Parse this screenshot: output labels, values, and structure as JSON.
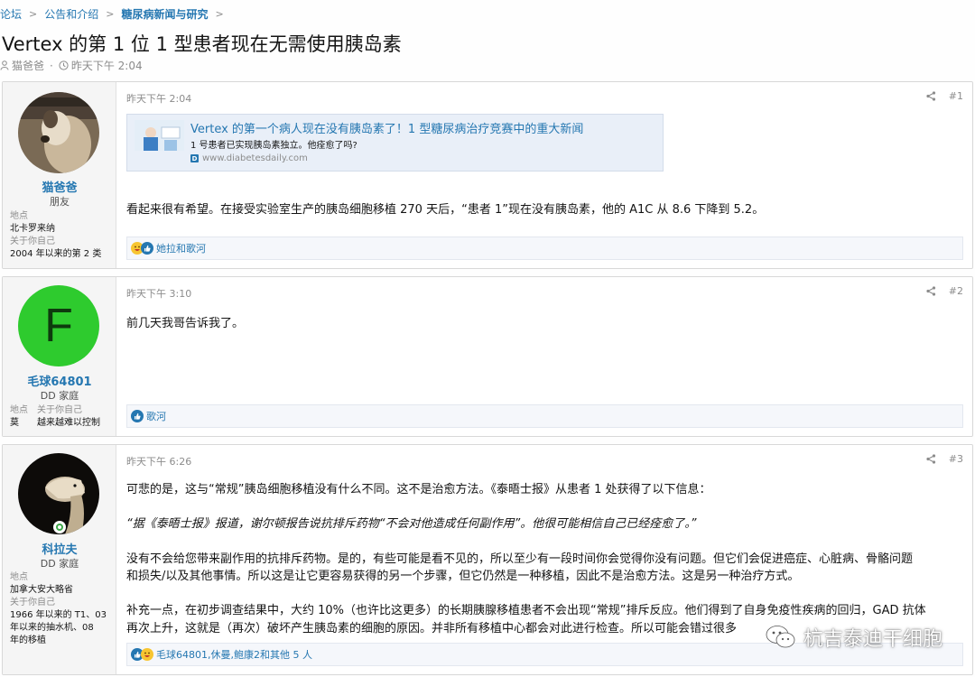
{
  "breadcrumb": {
    "items": [
      "论坛",
      "公告和介绍",
      "糖尿病新闻与研究"
    ]
  },
  "thread": {
    "title": "Vertex 的第 1 位 1 型患者现在无需使用胰岛素",
    "author": "猫爸爸",
    "time": "昨天下午 2:04"
  },
  "posts": [
    {
      "username": "猫爸爸",
      "user_title": "朋友",
      "fields": [
        {
          "label": "地点",
          "value": "北卡罗来纳"
        },
        {
          "label": "关于你自己",
          "value": "2004 年以来的第 2 类"
        }
      ],
      "date": "昨天下午 2:04",
      "number": "#1",
      "link_card": {
        "title": "Vertex 的第一个病人现在没有胰岛素了！1 型糖尿病治疗竞赛中的重大新闻",
        "description": "1 号患者已实现胰岛素独立。他痊愈了吗?",
        "favicon": "D",
        "domain": "www.diabetesdaily.com"
      },
      "body": [
        "看起来很有希望。在接受实验室生产的胰岛细胞移植 270 天后，“患者 1”现在没有胰岛素，他的 A1C 从 8.6 下降到 5.2。"
      ],
      "reactions": "她拉和歌河"
    },
    {
      "username": "毛球64801",
      "user_title": "DD 家庭",
      "avatar_letter": "F",
      "avatar_color": "#2ecb2e",
      "fields": [
        {
          "label": "地点",
          "value": "莫"
        },
        {
          "label": "关于你自己",
          "value": "越来越难以控制"
        }
      ],
      "date": "昨天下午 3:10",
      "number": "#2",
      "body": [
        "前几天我哥告诉我了。"
      ],
      "reactions": "歌河"
    },
    {
      "username": "科拉夫",
      "user_title": "DD 家庭",
      "fields": [
        {
          "label": "地点",
          "value": "加拿大安大略省"
        },
        {
          "label": "关于你自己",
          "value": "1966 年以来的 T1、03 年以来的抽水机、08 年的移植"
        }
      ],
      "about_lines": [
        "1966 年以来的 T1、03",
        "年以来的抽水机、08",
        "年的移植"
      ],
      "date": "昨天下午 6:26",
      "number": "#3",
      "body": [
        "可悲的是，这与“常规”胰岛细胞移植没有什么不同。这不是治愈方法。《泰晤士报》从患者 1 处获得了以下信息：",
        "“据《泰晤士报》报道，谢尔顿报告说抗排斥药物“不会对他造成任何副作用”。他很可能相信自己已经痊愈了。”",
        "没有不会给您带来副作用的抗排斥药物。是的，有些可能是看不见的，所以至少有一段时间你会觉得你没有问题。但它们会促进癌症、心脏病、骨骼问题",
        "和损失/以及其他事情。所以这是让它更容易获得的另一个步骤，但它仍然是一种移植，因此不是治愈方法。这是另一种治疗方式。",
        "补充一点，在初步调查结果中，大约 10%（也许比这更多）的长期胰腺移植患者不会出现“常规”排斥反应。他们得到了自身免疫性疾病的回归，GAD 抗体",
        "再次上升，这就是（再次）破坏产生胰岛素的细胞的原因。并非所有移植中心都会对此进行检查。所以可能会错过很多"
      ],
      "reactions": "毛球64801,休曼,鲍康2和其他 5 人"
    }
  ],
  "watermark": "杭吉泰迪干细胞",
  "colors": {
    "link": "#2577b1",
    "muted": "#8c8c8c",
    "sidebar": "#f5f5f5",
    "link_card_bg": "#e9eff8"
  },
  "icons": [
    "chevron-right-icon",
    "user-icon",
    "clock-icon",
    "share-icon",
    "like-reaction-icon",
    "haha-reaction-icon",
    "online-status-icon",
    "wechat-icon"
  ]
}
